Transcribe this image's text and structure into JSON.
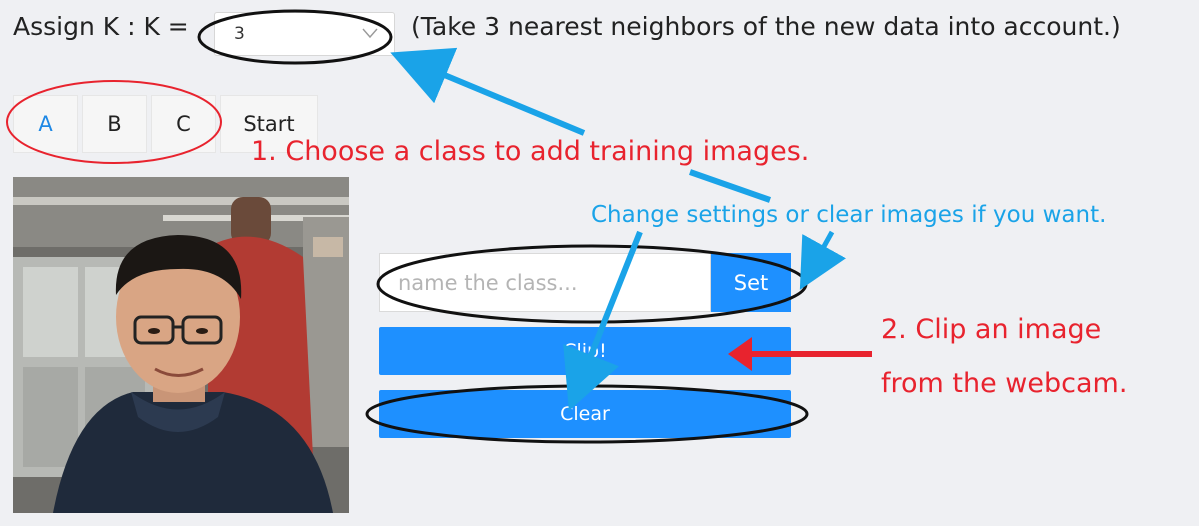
{
  "k_setting": {
    "label": "Assign K : K =",
    "selected": "3",
    "description": "(Take 3 nearest neighbors of the new data into account.)"
  },
  "class_tabs": [
    {
      "label": "A",
      "active": true
    },
    {
      "label": "B",
      "active": false
    },
    {
      "label": "C",
      "active": false
    }
  ],
  "start_label": "Start",
  "name_input": {
    "placeholder": "name the class...",
    "value": ""
  },
  "set_label": "Set",
  "clip_label": "Clip!",
  "clear_label": "Clear",
  "annotations": {
    "step1": "1. Choose a class to add training images.",
    "settings": "Change settings or clear images if you want.",
    "step2_line1": "2. Clip an image",
    "step2_line2": "from the webcam."
  },
  "colors": {
    "accent": "#1e90ff",
    "active_tab_text": "#1e88e5",
    "annotation_red": "#e8232e",
    "annotation_blue": "#1aa3e8",
    "background": "#eff0f3"
  },
  "icons": {
    "select_caret": "chevron-down-icon"
  }
}
